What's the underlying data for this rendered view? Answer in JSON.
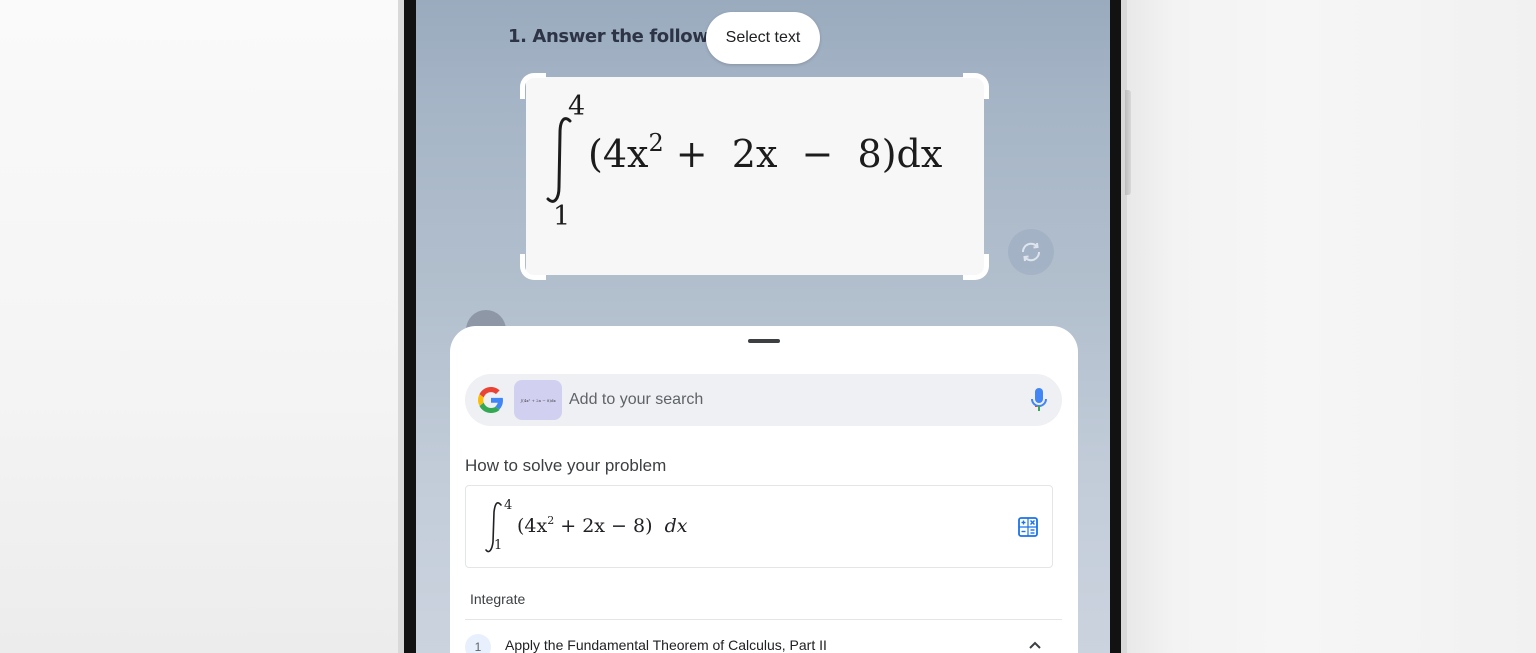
{
  "screen": {
    "question_text": "1. Answer the following",
    "select_text_label": "Select text"
  },
  "equation_large": {
    "upper_limit": "4",
    "lower_limit": "1",
    "expression_base": "(4x",
    "exponent": "2",
    "expression_rest": " +  2x  −  8)dx"
  },
  "search": {
    "placeholder": "Add to your search",
    "thumbnail_text": "∫(4x² + 2x − 8)dx"
  },
  "result": {
    "title": "How to solve your problem",
    "equation": {
      "upper_limit": "4",
      "lower_limit": "1",
      "expression_base": "(4x",
      "exponent": "2",
      "expression_rest": " + 2x − 8)",
      "differential": "dx"
    },
    "method_label": "Integrate",
    "step": {
      "number": "1",
      "text": "Apply the Fundamental Theorem of Calculus, Part II"
    }
  },
  "icons": {
    "google": "google-g-icon",
    "mic": "microphone-icon",
    "calculator": "calculator-icon",
    "refresh": "refresh-icon",
    "chevron": "chevron-up-icon"
  },
  "colors": {
    "google_blue": "#4285F4",
    "google_red": "#EA4335",
    "google_yellow": "#FBBC05",
    "google_green": "#34A853"
  }
}
